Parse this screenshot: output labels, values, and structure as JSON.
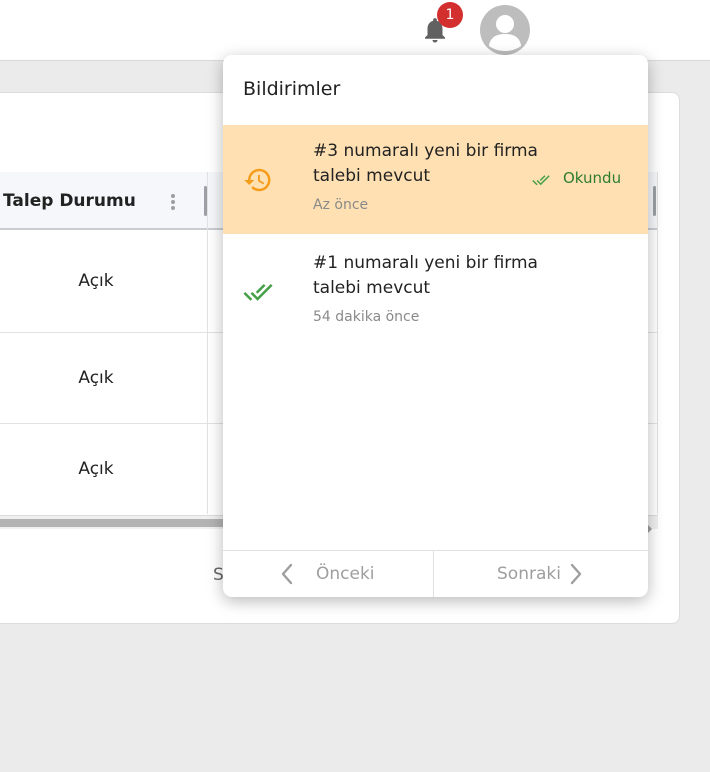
{
  "header": {
    "notification_count": "1",
    "icons": [
      "bell-icon",
      "account-circle-icon"
    ]
  },
  "table": {
    "columns": [
      "Talep Durumu"
    ],
    "rows": [
      {
        "talep_durumu": "Açık"
      },
      {
        "talep_durumu": "Açık"
      },
      {
        "talep_durumu": "Açık"
      }
    ],
    "footer_partial_text": "S"
  },
  "notifications_panel": {
    "title": "Bildirimler",
    "items": [
      {
        "text": "#3 numaralı yeni bir firma talebi mevcut",
        "time": "Az önce",
        "status": "unread",
        "icon": "history-icon",
        "action_label": "Okundu",
        "action_icon": "double-check-icon"
      },
      {
        "text": "#1 numaralı yeni bir firma talebi mevcut",
        "time": "54 dakika önce",
        "status": "read",
        "icon": "double-check-icon"
      }
    ],
    "footer": {
      "previous_label": "Önceki",
      "next_label": "Sonraki"
    }
  },
  "colors": {
    "unread_highlight": "#ffe0b2",
    "accent_orange": "#f59c1a",
    "read_green": "#43a047",
    "badge_red": "#d32f2f",
    "muted_text": "#9e9e9e"
  }
}
